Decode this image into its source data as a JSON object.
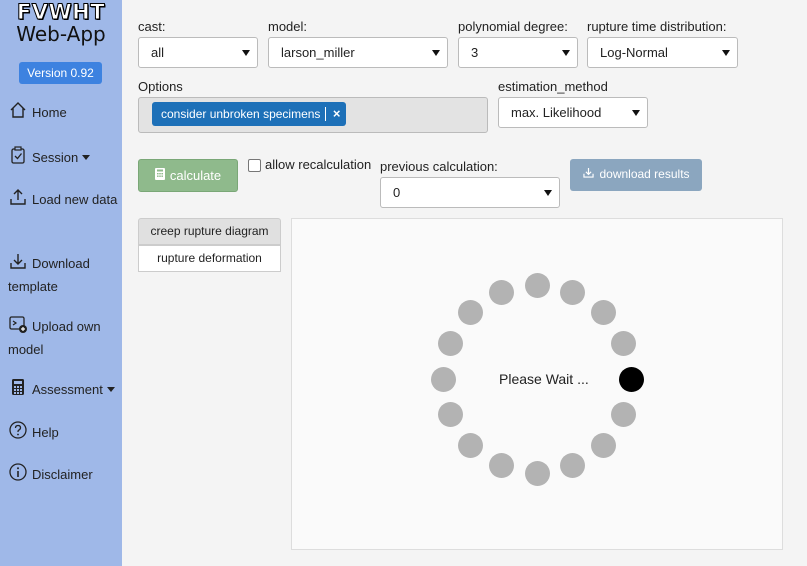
{
  "app": {
    "title_line1": "FVWHT",
    "title_line2": "Web-App",
    "version": "Version 0.92"
  },
  "sidebar": {
    "items": [
      {
        "label": "Home",
        "icon": "home-icon"
      },
      {
        "label": "Session",
        "icon": "clipboard-check-icon",
        "dropdown": true
      },
      {
        "label": "Load new data",
        "icon": "upload-icon"
      },
      {
        "label": "Download template",
        "icon": "download-icon"
      },
      {
        "label": "Upload own model",
        "icon": "terminal-plus-icon"
      },
      {
        "label": "Assessment",
        "icon": "calculator-icon",
        "dropdown": true
      },
      {
        "label": "Help",
        "icon": "question-circle-icon"
      },
      {
        "label": "Disclaimer",
        "icon": "info-circle-icon"
      }
    ]
  },
  "filters": {
    "cast": {
      "label": "cast:",
      "value": "all"
    },
    "model": {
      "label": "model:",
      "value": "larson_miller"
    },
    "degree": {
      "label": "polynomial degree:",
      "value": "3"
    },
    "distribution": {
      "label": "rupture time distribution:",
      "value": "Log-Normal"
    }
  },
  "options": {
    "label": "Options",
    "chips": [
      "consider unbroken specimens"
    ],
    "chip_remove": "×"
  },
  "estimation": {
    "label": "estimation_method",
    "value": "max. Likelihood"
  },
  "actions": {
    "calculate": "calculate",
    "allow_recalc": "allow recalculation",
    "previous_label": "previous calculation:",
    "previous_value": "0",
    "download": "download results"
  },
  "tabs": {
    "diagram": "creep rupture diagram",
    "deformation": "rupture deformation"
  },
  "loading": {
    "text": "Please Wait ...",
    "dot_count": 16,
    "active_dot_index": 4
  },
  "colors": {
    "sidebar_bg": "#9fb8e8",
    "version_badge": "#3d82e0",
    "chip": "#1d70b8",
    "calculate_btn": "#8fba8c",
    "download_btn": "#8ba6bf",
    "spinner_dot": "#b3b3b3",
    "spinner_active": "#000000"
  }
}
